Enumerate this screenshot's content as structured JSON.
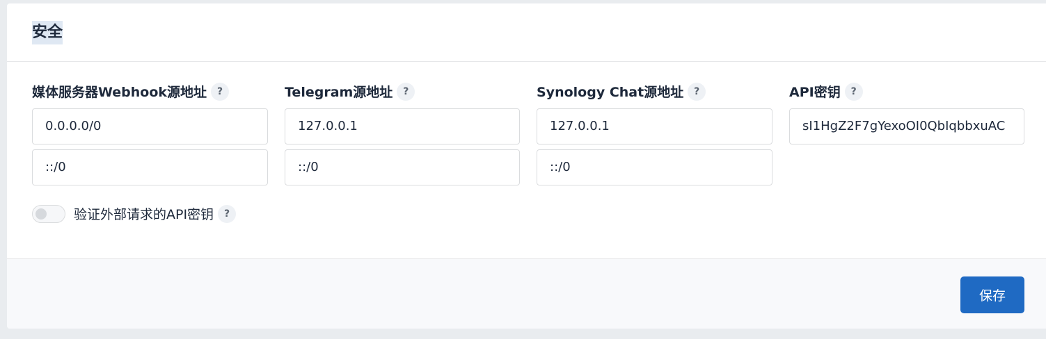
{
  "section": {
    "title": "安全"
  },
  "fields": [
    {
      "label": "媒体服务器Webhook源地址",
      "values": [
        "0.0.0.0/0",
        "::/0"
      ]
    },
    {
      "label": "Telegram源地址",
      "values": [
        "127.0.0.1",
        "::/0"
      ]
    },
    {
      "label": "Synology Chat源地址",
      "values": [
        "127.0.0.1",
        "::/0"
      ]
    },
    {
      "label": "API密钥",
      "values": [
        "sI1HgZ2F7gYexoOI0QbIqbbxuAC"
      ]
    }
  ],
  "help_symbol": "?",
  "toggle": {
    "label": "验证外部请求的API密钥",
    "checked": false
  },
  "footer": {
    "save_label": "保存"
  },
  "colors": {
    "primary": "#1f6ac3",
    "background": "#e9ecef"
  }
}
